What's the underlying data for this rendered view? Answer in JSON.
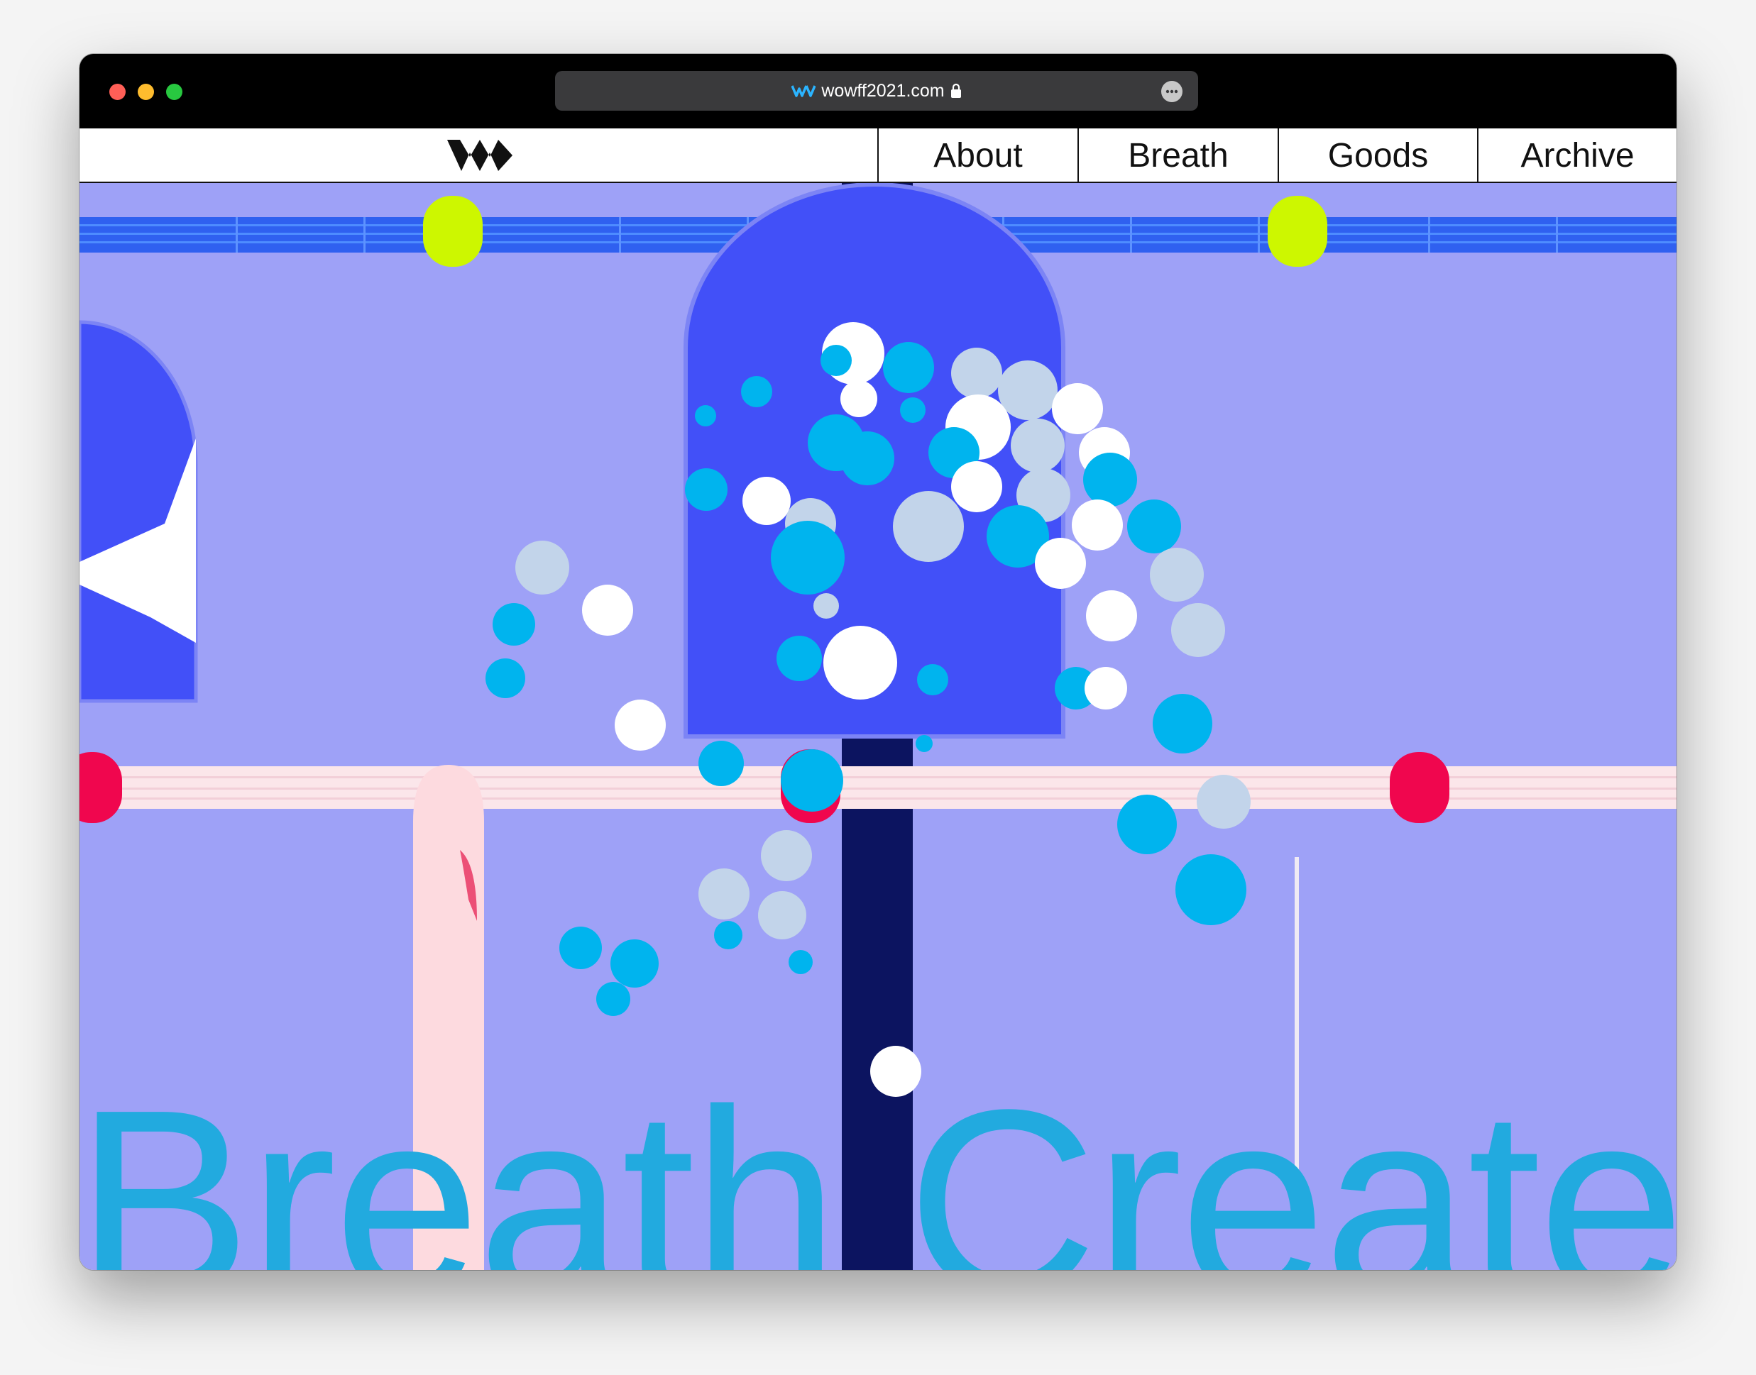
{
  "browser": {
    "url": "wowff2021.com",
    "site_icon": "wave-logo-icon",
    "lock_icon": "lock-icon",
    "more_icon": "ellipsis-icon",
    "traffic_lights": {
      "close": "#ff5f57",
      "minimize": "#febc2e",
      "maximize": "#28c840"
    }
  },
  "nav": {
    "logo": "wowff-logo-icon",
    "items": [
      {
        "label": "About"
      },
      {
        "label": "Breath"
      },
      {
        "label": "Goods"
      },
      {
        "label": "Archive"
      }
    ]
  },
  "hero": {
    "headline": "Breath Create",
    "colors": {
      "background": "#9ea1f7",
      "headline": "#22aadf",
      "arch": "#4250f8",
      "pole": "#0c1460",
      "rail_top": "#2f60f0",
      "knob_top": "#cdf700",
      "rail_bottom": "#fbe6ea",
      "knob_bottom": "#f0064e",
      "bubble_cyan": "#00b4ee",
      "bubble_white": "#ffffff",
      "bubble_grey": "#c2d4ea"
    }
  }
}
